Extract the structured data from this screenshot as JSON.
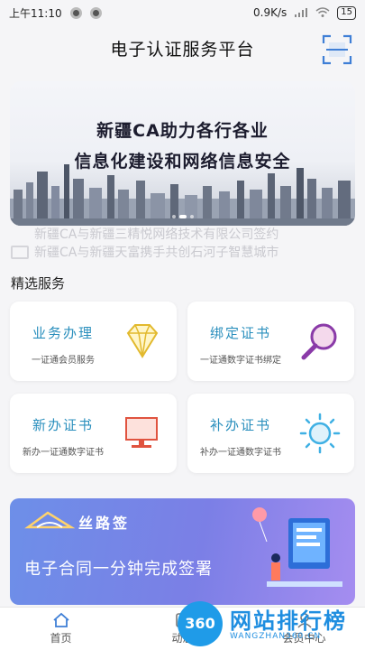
{
  "status_bar": {
    "time": "上午11:10",
    "speed": "0.9K/s",
    "battery": "15"
  },
  "header": {
    "title": "电子认证服务平台"
  },
  "banner": {
    "line1": "新疆CA助力各行各业",
    "line2": "信息化建设和网络信息安全"
  },
  "news": [
    "新疆CA与新疆三精悦网络技术有限公司签约",
    "新疆CA与新疆天富携手共创石河子智慧城市"
  ],
  "services": {
    "title": "精选服务",
    "items": [
      {
        "name": "业务办理",
        "desc": "一证通会员服务",
        "icon": "diamond-icon"
      },
      {
        "name": "绑定证书",
        "desc": "一证通数字证书绑定",
        "icon": "magnifier-icon"
      },
      {
        "name": "新办证书",
        "desc": "新办一证通数字证书",
        "icon": "monitor-icon"
      },
      {
        "name": "补办证书",
        "desc": "补办一证通数字证书",
        "icon": "sun-icon"
      }
    ]
  },
  "promo": {
    "brand": "丝路签",
    "tagline": "电子合同一分钟完成签署"
  },
  "tabs": [
    {
      "label": "首页",
      "icon": "home-icon"
    },
    {
      "label": "动态",
      "icon": "news-icon"
    },
    {
      "label": "会员中心",
      "icon": "user-icon"
    }
  ],
  "watermark": {
    "logo": "360",
    "title": "网站排行榜",
    "url": "WANGZHAN360.CN"
  }
}
